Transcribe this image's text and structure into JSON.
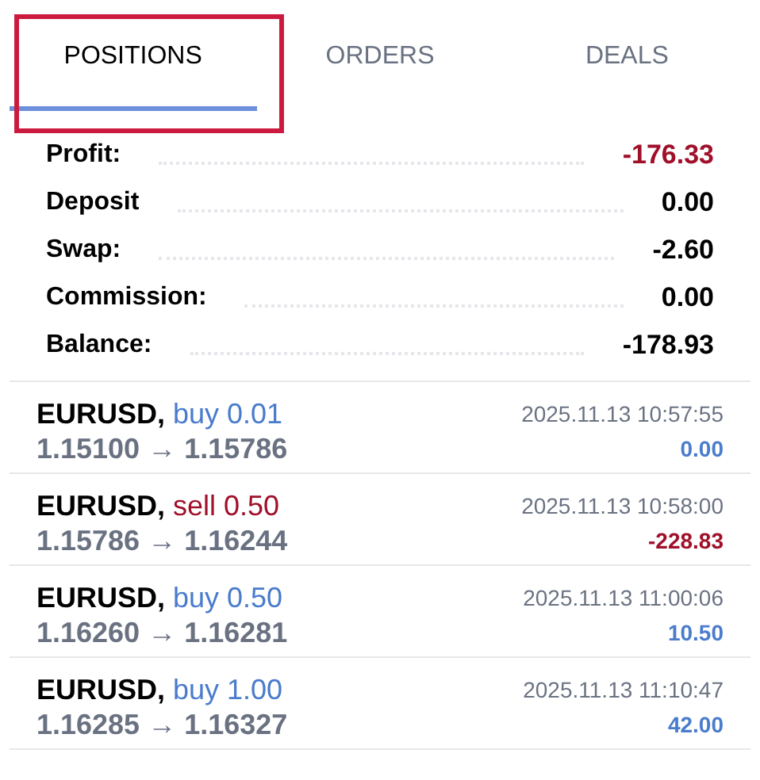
{
  "highlight_frame": true,
  "tabs": [
    {
      "label": "POSITIONS",
      "selected": true
    },
    {
      "label": "ORDERS",
      "selected": false
    },
    {
      "label": "DEALS",
      "selected": false
    }
  ],
  "summary": [
    {
      "label": "Profit:",
      "value": "-176.33",
      "loss": true
    },
    {
      "label": "Deposit",
      "value": "0.00",
      "loss": false
    },
    {
      "label": "Swap:",
      "value": "-2.60",
      "loss": false
    },
    {
      "label": "Commission:",
      "value": "0.00",
      "loss": false
    },
    {
      "label": "Balance:",
      "value": "-178.93",
      "loss": false
    }
  ],
  "positions": [
    {
      "symbol": "EURUSD,",
      "kind": "buy",
      "trade": "buy 0.01",
      "prices": "1.15100 → 1.15786",
      "time": "2025.11.13 10:57:55",
      "profit": "0.00",
      "loss": false
    },
    {
      "symbol": "EURUSD,",
      "kind": "sell",
      "trade": "sell 0.50",
      "prices": "1.15786 → 1.16244",
      "time": "2025.11.13 10:58:00",
      "profit": "-228.83",
      "loss": true
    },
    {
      "symbol": "EURUSD,",
      "kind": "buy",
      "trade": "buy 0.50",
      "prices": "1.16260 → 1.16281",
      "time": "2025.11.13 11:00:06",
      "profit": "10.50",
      "loss": false
    },
    {
      "symbol": "EURUSD,",
      "kind": "buy",
      "trade": "buy 1.00",
      "prices": "1.16285 → 1.16327",
      "time": "2025.11.13 11:10:47",
      "profit": "42.00",
      "loss": false
    }
  ]
}
